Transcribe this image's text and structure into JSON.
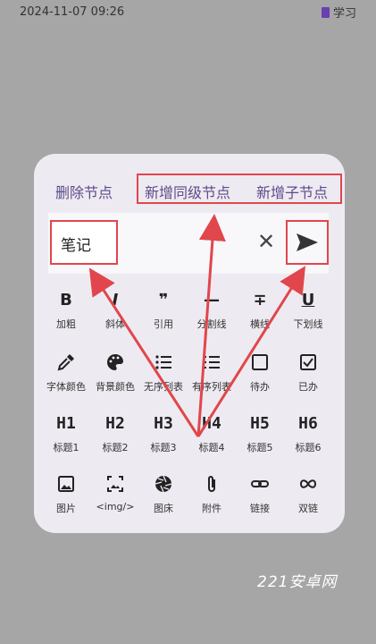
{
  "status": {
    "time": "2024-11-07 09:26",
    "app": "学习"
  },
  "top_actions": {
    "delete": "删除节点",
    "add_sibling": "新增同级节点",
    "add_child": "新增子节点"
  },
  "input": {
    "value": "笔记"
  },
  "tools": [
    {
      "label": "加粗",
      "icon": "B",
      "icon_name": "bold-icon"
    },
    {
      "label": "斜体",
      "icon": "I",
      "icon_name": "italic-icon"
    },
    {
      "label": "引用",
      "icon": "❞",
      "icon_name": "quote-icon"
    },
    {
      "label": "分割线",
      "icon": "—",
      "icon_name": "divider-icon"
    },
    {
      "label": "横线",
      "icon": "∓",
      "icon_name": "strikethrough-icon"
    },
    {
      "label": "下划线",
      "icon": "U",
      "icon_name": "underline-icon"
    },
    {
      "label": "字体颜色",
      "icon": "",
      "icon_name": "eyedropper-icon"
    },
    {
      "label": "背景颜色",
      "icon": "",
      "icon_name": "palette-icon"
    },
    {
      "label": "无序列表",
      "icon": "",
      "icon_name": "bullet-list-icon"
    },
    {
      "label": "有序列表",
      "icon": "",
      "icon_name": "numbered-list-icon"
    },
    {
      "label": "待办",
      "icon": "",
      "icon_name": "checkbox-empty-icon"
    },
    {
      "label": "已办",
      "icon": "",
      "icon_name": "checkbox-checked-icon"
    },
    {
      "label": "标题1",
      "icon": "H1",
      "icon_name": "heading-1-icon"
    },
    {
      "label": "标题2",
      "icon": "H2",
      "icon_name": "heading-2-icon"
    },
    {
      "label": "标题3",
      "icon": "H3",
      "icon_name": "heading-3-icon"
    },
    {
      "label": "标题4",
      "icon": "H4",
      "icon_name": "heading-4-icon"
    },
    {
      "label": "标题5",
      "icon": "H5",
      "icon_name": "heading-5-icon"
    },
    {
      "label": "标题6",
      "icon": "H6",
      "icon_name": "heading-6-icon"
    },
    {
      "label": "图片",
      "icon": "",
      "icon_name": "image-icon"
    },
    {
      "label": "<img/>",
      "icon": "",
      "icon_name": "image-tag-icon"
    },
    {
      "label": "图床",
      "icon": "",
      "icon_name": "aperture-icon"
    },
    {
      "label": "附件",
      "icon": "",
      "icon_name": "paperclip-icon"
    },
    {
      "label": "链接",
      "icon": "",
      "icon_name": "link-icon"
    },
    {
      "label": "双链",
      "icon": "",
      "icon_name": "infinity-icon"
    }
  ],
  "watermark": "221安卓网",
  "colors": {
    "accent": "#5d4b8a",
    "highlight": "#e0464c",
    "panel": "#eeeaf1",
    "background": "#a6a6a6"
  }
}
